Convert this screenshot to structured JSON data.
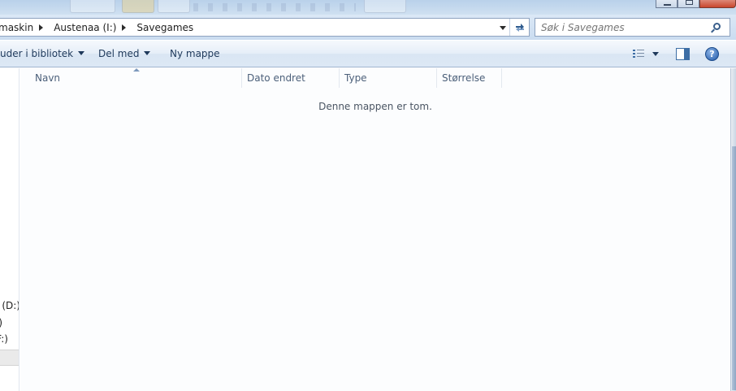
{
  "address_bar": {
    "breadcrumbs": [
      "maskin",
      "Austenaa (I:)",
      "Savegames"
    ],
    "refresh_icon": "refresh-icon",
    "dropdown_icon": "chevron-down-icon"
  },
  "search": {
    "placeholder": "Søk i Savegames",
    "icon": "search-icon"
  },
  "toolbar": {
    "include_in_library": "uder i bibliotek",
    "share_with": "Del med",
    "new_folder": "Ny mappe",
    "views_icon": "view-details-icon",
    "preview_icon": "preview-pane-icon",
    "help_icon": "help-icon",
    "help_glyph": "?"
  },
  "navigation": {
    "items": [
      "n (D:)",
      ")",
      "F:)"
    ]
  },
  "file_list": {
    "columns": [
      "Navn",
      "Dato endret",
      "Type",
      "Størrelse"
    ],
    "sorted_by": "Navn",
    "empty_message": "Denne mappen er tom."
  },
  "window_controls": [
    "minimize",
    "maximize",
    "close"
  ]
}
